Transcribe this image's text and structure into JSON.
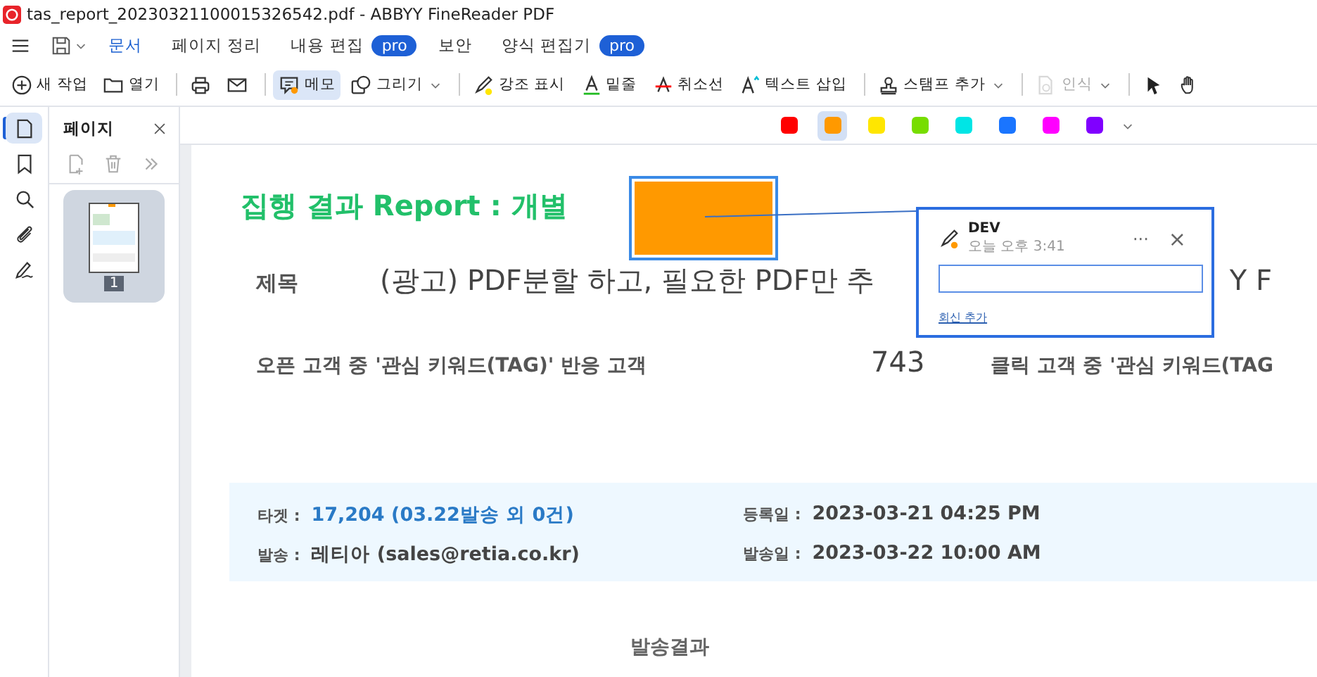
{
  "window": {
    "title": "tas_report_20230321100015326542.pdf - ABBYY FineReader PDF"
  },
  "menu_tabs": [
    {
      "label": "문서",
      "selected": true
    },
    {
      "label": "페이지 정리",
      "selected": false
    },
    {
      "label": "내용 편집",
      "badge": "pro",
      "selected": false
    },
    {
      "label": "보안",
      "selected": false
    },
    {
      "label": "양식 편집기",
      "badge": "pro",
      "selected": false
    }
  ],
  "toolbar": {
    "groups": [
      [
        {
          "label": "새 작업",
          "dropdown": false,
          "selected": false,
          "disabled": false
        },
        {
          "label": "열기",
          "dropdown": false,
          "selected": false,
          "disabled": false
        }
      ],
      [
        {
          "dropdown": false,
          "selected": false,
          "disabled": false
        },
        {
          "dropdown": false,
          "selected": false,
          "disabled": false
        }
      ],
      [
        {
          "label": "메모",
          "dropdown": false,
          "selected": true,
          "disabled": false
        },
        {
          "label": "그리기",
          "dropdown": true,
          "selected": false,
          "disabled": false
        }
      ],
      [
        {
          "label": "강조 표시",
          "dropdown": false,
          "selected": false,
          "disabled": false
        },
        {
          "label": "밑줄",
          "dropdown": false,
          "selected": false,
          "disabled": false
        },
        {
          "label": "취소선",
          "dropdown": false,
          "selected": false,
          "disabled": false
        },
        {
          "label": "텍스트 삽입",
          "dropdown": false,
          "selected": false,
          "disabled": false
        }
      ],
      [
        {
          "label": "스탬프 추가",
          "dropdown": true,
          "selected": false,
          "disabled": false
        }
      ],
      [
        {
          "label": "인식",
          "dropdown": true,
          "selected": false,
          "disabled": true
        }
      ],
      [
        {
          "dropdown": false,
          "selected": false,
          "disabled": false
        },
        {
          "dropdown": false,
          "selected": false,
          "disabled": false
        }
      ]
    ]
  },
  "colors": [
    {
      "color": "#ff0000",
      "selected": false
    },
    {
      "color": "#ff9900",
      "selected": true
    },
    {
      "color": "#ffe600",
      "selected": false
    },
    {
      "color": "#77dd00",
      "selected": false
    },
    {
      "color": "#00e5e5",
      "selected": false
    },
    {
      "color": "#1a75ff",
      "selected": false
    },
    {
      "color": "#ff00ff",
      "selected": false
    },
    {
      "color": "#8000ff",
      "selected": false
    }
  ],
  "sidebar": {
    "rail": [
      {
        "selected": true
      },
      {
        "selected": false
      },
      {
        "selected": false
      },
      {
        "selected": false
      },
      {
        "selected": false
      }
    ],
    "panel": {
      "title": "페이지",
      "pages": [
        {
          "label": "1",
          "selected": true
        }
      ]
    }
  },
  "document": {
    "heading": "집행 결과 Report : 개별",
    "subject_label": "제목",
    "subject_text": "(광고) PDF분할 하고, 필요한 PDF만 추",
    "subject_tail": "Y F",
    "stat_label": "오픈 고객 중 '관심 키워드(TAG)' 반응 고객",
    "stat_value": "743",
    "stat_label_2": "클릭 고객 중 '관심 키워드(TAG",
    "info": [
      {
        "label": "타겟 :",
        "value": "17,204 (03.22발송 외 0건)",
        "kind": "link"
      },
      {
        "label": "등록일 :",
        "value": "2023-03-21 04:25 PM",
        "kind": "plain"
      },
      {
        "label": "발송 :",
        "value": "레티아 (sales@retia.co.kr)",
        "kind": "plain"
      },
      {
        "label": "발송일 :",
        "value": "2023-03-22 10:00 AM",
        "kind": "plain"
      }
    ],
    "section_title": "발송결과"
  },
  "note": {
    "author": "DEV",
    "time": "오늘 오후 3:41",
    "menu": "···",
    "close": "×",
    "reply_link": "회신 추가"
  }
}
